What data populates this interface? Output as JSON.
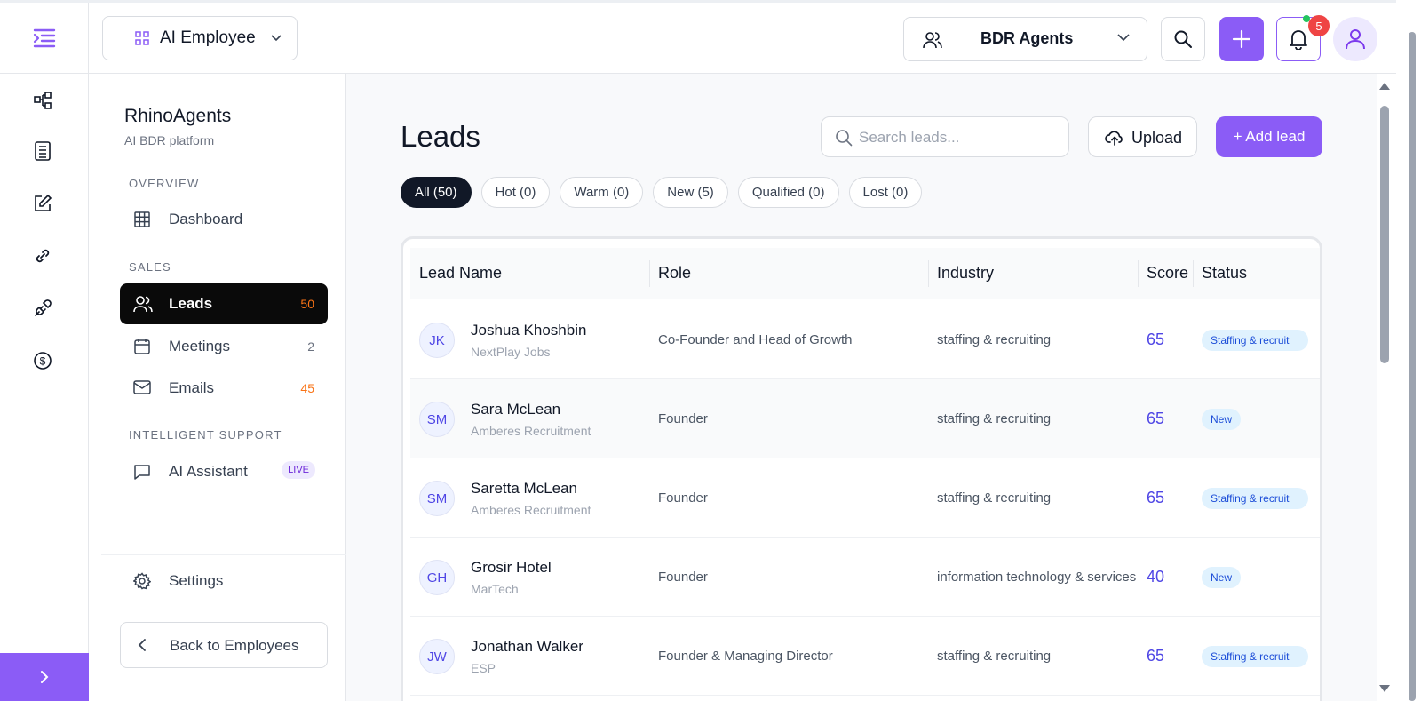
{
  "colors": {
    "accent": "#8b5cf6",
    "active_nav": "#0a0a0a",
    "score": "#4f46e5",
    "warning": "#f97316"
  },
  "topbar": {
    "employee_select": {
      "label": "AI Employee",
      "icon": "grid-icon"
    },
    "agent_select": {
      "label": "BDR Agents",
      "icon": "users-icon"
    },
    "notifications_count": "5"
  },
  "sidebar": {
    "brand": "RhinoAgents",
    "brand_sub": "AI BDR platform",
    "sections": [
      "OVERVIEW",
      "SALES",
      "INTELLIGENT SUPPORT"
    ],
    "items": {
      "dashboard": {
        "label": "Dashboard",
        "icon": "dashboard-grid-icon"
      },
      "leads": {
        "label": "Leads",
        "count": "50",
        "icon": "users-icon"
      },
      "meetings": {
        "label": "Meetings",
        "count": "2",
        "icon": "calendar-icon"
      },
      "emails": {
        "label": "Emails",
        "count": "45",
        "icon": "mail-icon"
      },
      "assistant": {
        "label": "AI Assistant",
        "badge": "LIVE",
        "icon": "chat-icon"
      },
      "settings": {
        "label": "Settings",
        "icon": "gear-icon"
      }
    },
    "back_label": "Back to Employees"
  },
  "main": {
    "title": "Leads",
    "search_placeholder": "Search leads...",
    "upload_label": "Upload",
    "add_lead_label": "+ Add lead",
    "filters": [
      "All (50)",
      "Hot (0)",
      "Warm (0)",
      "New (5)",
      "Qualified (0)",
      "Lost (0)"
    ],
    "columns": [
      "Lead Name",
      "Role",
      "Industry",
      "Score",
      "Status"
    ],
    "rows": [
      {
        "initials": "JK",
        "name": "Joshua Khoshbin",
        "company": "NextPlay Jobs",
        "role": "Co-Founder and Head of Growth",
        "industry": "staffing & recruiting",
        "score": "65",
        "status": "Staffing & recruit"
      },
      {
        "initials": "SM",
        "name": "Sara McLean",
        "company": "Amberes Recruitment",
        "role": "Founder",
        "industry": "staffing & recruiting",
        "score": "65",
        "status": "New"
      },
      {
        "initials": "SM",
        "name": "Saretta McLean",
        "company": "Amberes Recruitment",
        "role": "Founder",
        "industry": "staffing & recruiting",
        "score": "65",
        "status": "Staffing & recruit"
      },
      {
        "initials": "GH",
        "name": "Grosir Hotel",
        "company": "MarTech",
        "role": "Founder",
        "industry": "information technology & services",
        "score": "40",
        "status": "New"
      },
      {
        "initials": "JW",
        "name": "Jonathan Walker",
        "company": "ESP",
        "role": "Founder & Managing Director",
        "industry": "staffing & recruiting",
        "score": "65",
        "status": "Staffing & recruit"
      }
    ]
  }
}
